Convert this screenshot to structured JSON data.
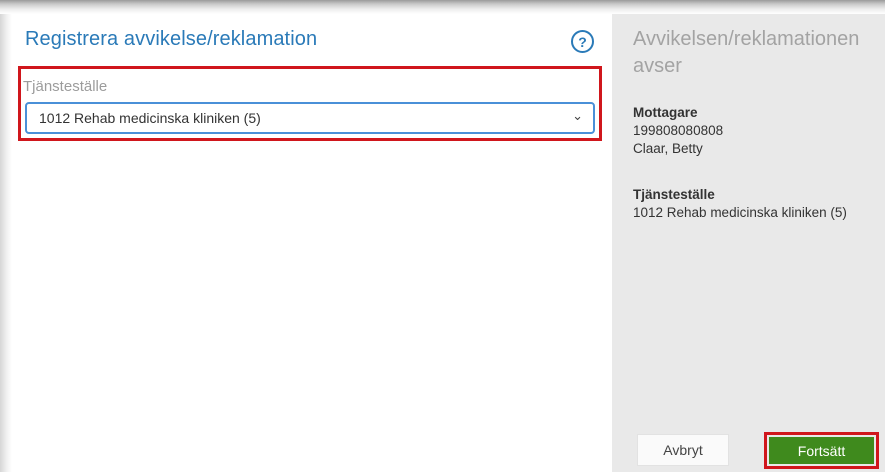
{
  "dialog": {
    "title": "Registrera avvikelse/reklamation",
    "help_icon": "help-icon",
    "help_symbol": "?"
  },
  "form": {
    "field_label": "Tjänsteställe",
    "selected_value": "1012 Rehab medicinska kliniken (5)",
    "chevron_icon": "chevron-down-icon",
    "chevron_symbol": "⌄"
  },
  "summary": {
    "title": "Avvikelsen/reklamationen avser",
    "recipient_label": "Mottagare",
    "recipient_id": "199808080808",
    "recipient_name": "Claar, Betty",
    "location_label": "Tjänsteställe",
    "location_value": "1012 Rehab medicinska kliniken (5)"
  },
  "actions": {
    "cancel_label": "Avbryt",
    "continue_label": "Fortsätt"
  },
  "colors": {
    "accent": "#2a7ab8",
    "highlight_border": "#d0161c",
    "primary_button": "#3f8a1d",
    "side_panel": "#e9e9e9"
  }
}
